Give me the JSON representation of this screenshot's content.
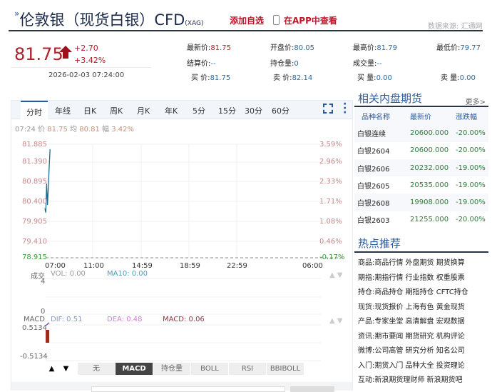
{
  "header": {
    "title": "伦敦银（现货白银）CFD",
    "code": "(XAG)",
    "add_watch": "添加自选",
    "view_app": "在APP中查看",
    "source": "数据来源: 汇通网"
  },
  "quote": {
    "price": "81.75",
    "change": "+2.70",
    "change_pct": "+3.42%",
    "time": "2026-02-03 07:24:00",
    "fields": [
      {
        "label": "最新价:",
        "value": "81.75"
      },
      {
        "label": "开盘价:",
        "value": "80.05"
      },
      {
        "label": "最高价:",
        "value": "81.79"
      },
      {
        "label": "最低价:",
        "value": "79.77"
      },
      {
        "label": "结算价:",
        "value": "--"
      },
      {
        "label": "持仓量:",
        "value": "0"
      },
      {
        "label": "成交量:",
        "value": "--"
      },
      {
        "label": "买 价:",
        "value": "81.75"
      },
      {
        "label": "卖 价:",
        "value": "82.14"
      },
      {
        "label": "买 量:",
        "value": "0.00"
      },
      {
        "label": "卖 量:",
        "value": "0.00"
      }
    ]
  },
  "chart": {
    "tabs": [
      "分时",
      "年线",
      "日K",
      "周K",
      "月K",
      "年K",
      "5分",
      "15分",
      "30分",
      "60分"
    ],
    "info": {
      "time": "07:24",
      "price_label": "价",
      "price": "81.75",
      "avg_label": "均",
      "avg": "80.81",
      "amp_label": "幅",
      "amp": "3.42%"
    },
    "y_labels": [
      "81.885",
      "81.390",
      "80.895",
      "80.400",
      "79.905",
      "79.410",
      "78.915"
    ],
    "pct_labels": [
      "3.59%",
      "2.96%",
      "2.33%",
      "1.71%",
      "1.08%",
      "0.46%",
      "-0.17%"
    ],
    "x_labels": [
      "07:00",
      "11:00",
      "14:59",
      "18:59",
      "22:59",
      "06:00"
    ],
    "volume": {
      "label": "成交",
      "vol": "VOL: 0.00",
      "ma10": "MA10: 0.00",
      "top": "4",
      "bottom": "0"
    },
    "macd": {
      "label": "MACD",
      "dif": "DIF: 0.51",
      "dea": "DEA: 0.48",
      "macd": "MACD: 0.06",
      "top": "0.5134",
      "bottom": "-0.5134"
    },
    "indicator_buttons": [
      "无",
      "MACD",
      "持仓量",
      "BOLL",
      "RSI",
      "BBIBOLL"
    ],
    "up": "▲",
    "down": "▼"
  },
  "chart_data": {
    "type": "line",
    "x": [
      "07:00",
      "07:05",
      "07:10",
      "07:14",
      "07:17",
      "07:20",
      "07:24"
    ],
    "values": [
      80.2,
      80.1,
      80.85,
      80.3,
      80.75,
      81.3,
      81.75
    ],
    "ylim": [
      78.915,
      81.885
    ]
  },
  "colors": {
    "up": "#b0202a",
    "down": "#2e8b3a",
    "accent": "#2a5aa0"
  },
  "related": {
    "title": "相关内盘期货",
    "more": "更多>",
    "headers": [
      "品种名称",
      "最新价",
      "涨跌幅"
    ],
    "rows": [
      [
        "白银连续",
        "20600.000",
        "-20.00%"
      ],
      [
        "白银2604",
        "20600.000",
        "-20.00%"
      ],
      [
        "白银2606",
        "20232.000",
        "-19.00%"
      ],
      [
        "白银2605",
        "20535.000",
        "-19.00%"
      ],
      [
        "白银2608",
        "19908.000",
        "-19.00%"
      ],
      [
        "白银2603",
        "21255.000",
        "-20.00%"
      ]
    ]
  },
  "hot": {
    "title": "热点推荐",
    "rows": [
      [
        "商品:",
        "商品行情 外盘期货 期货换算"
      ],
      [
        "期指:",
        "期指行情 行业指数 权重股票"
      ],
      [
        "持仓:",
        "商品持仓 期指持仓 CFTC持仓"
      ],
      [
        "现货:",
        "现货报价 上海有色 黄金现货"
      ],
      [
        "产品:",
        "专家坐堂 高清解盘 宏观数据"
      ],
      [
        "资讯:",
        "期市要闻 期货研究 机构评论"
      ],
      [
        "微博:",
        "公司高管 研究分析 知名公司"
      ],
      [
        "入门:",
        "期货入门 品种大全 投资理论"
      ],
      [
        "互动:",
        "新浪期货理财师 新浪期货吧"
      ]
    ]
  }
}
